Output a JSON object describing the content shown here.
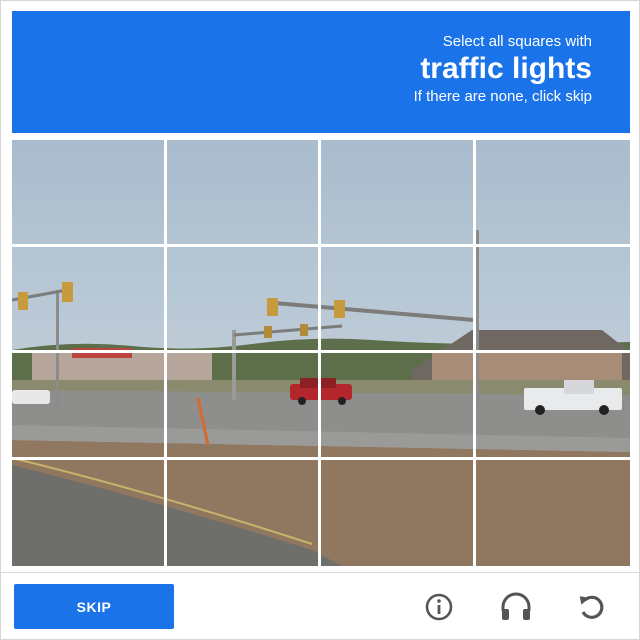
{
  "header": {
    "line1": "Select all squares with",
    "line2": "traffic lights",
    "line3": "If there are none, click skip"
  },
  "footer": {
    "skip_label": "SKIP"
  },
  "icons": {
    "info": "info-icon",
    "audio": "headphones-icon",
    "reload": "reload-icon"
  },
  "colors": {
    "accent": "#1a73e8",
    "icon": "#555555"
  }
}
